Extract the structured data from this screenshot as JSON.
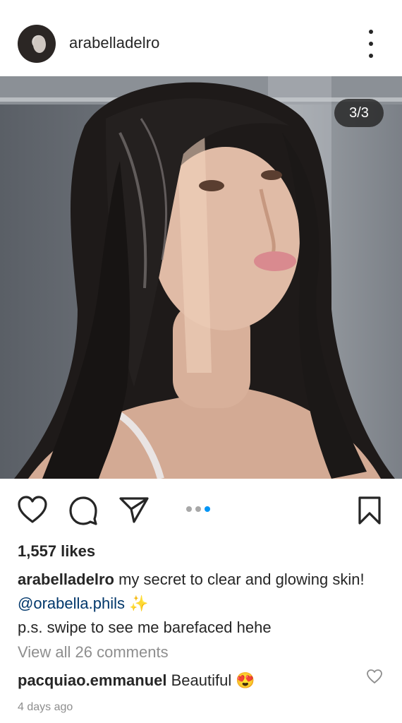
{
  "header": {
    "username": "arabelladelro"
  },
  "post": {
    "image_counter": "3/3",
    "carousel": {
      "total": 3,
      "active": 3
    },
    "likes": "1,557 likes",
    "caption": {
      "username": "arabelladelro",
      "text_line1": " my secret to clear and glowing skin! ",
      "mention": "@orabella.phils",
      "sparkles": "✨",
      "text_line2": "p.s. swipe to see me barefaced hehe"
    },
    "view_all_comments": "View all 26 comments",
    "top_comment": {
      "username": "pacquiao.emmanuel",
      "text": " Beautiful ",
      "emoji": "😍"
    },
    "timestamp": "4 days ago"
  },
  "icons": {
    "like": "heart-icon",
    "comment": "comment-icon",
    "share": "paper-plane-icon",
    "save": "bookmark-icon",
    "more": "more-vertical-icon"
  },
  "colors": {
    "accent": "#0095f6",
    "mention": "#00376b",
    "muted": "#8e8e8e",
    "text": "#262626"
  }
}
